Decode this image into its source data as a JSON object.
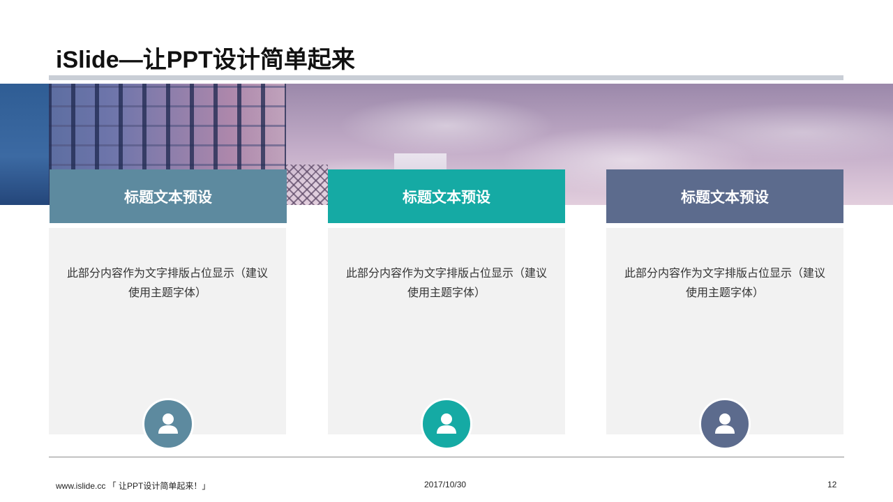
{
  "slide": {
    "title": "iSlide—让PPT设计简单起来"
  },
  "colors": {
    "title_bar": "#c9ced6",
    "card1": "#5d8a9f",
    "card2": "#15aaa4",
    "card3": "#5c6b8d",
    "card_body": "#f2f2f2"
  },
  "cards": [
    {
      "header": "标题文本预设",
      "text": "此部分内容作为文字排版占位显示（建议使用主题字体）",
      "icon": "user-icon"
    },
    {
      "header": "标题文本预设",
      "text": "此部分内容作为文字排版占位显示（建议使用主题字体）",
      "icon": "user-icon"
    },
    {
      "header": "标题文本预设",
      "text": "此部分内容作为文字排版占位显示（建议使用主题字体）",
      "icon": "user-icon"
    }
  ],
  "footer": {
    "left": "www.islide.cc 「 让PPT设计简单起来！」",
    "date": "2017/10/30",
    "page": "12"
  }
}
